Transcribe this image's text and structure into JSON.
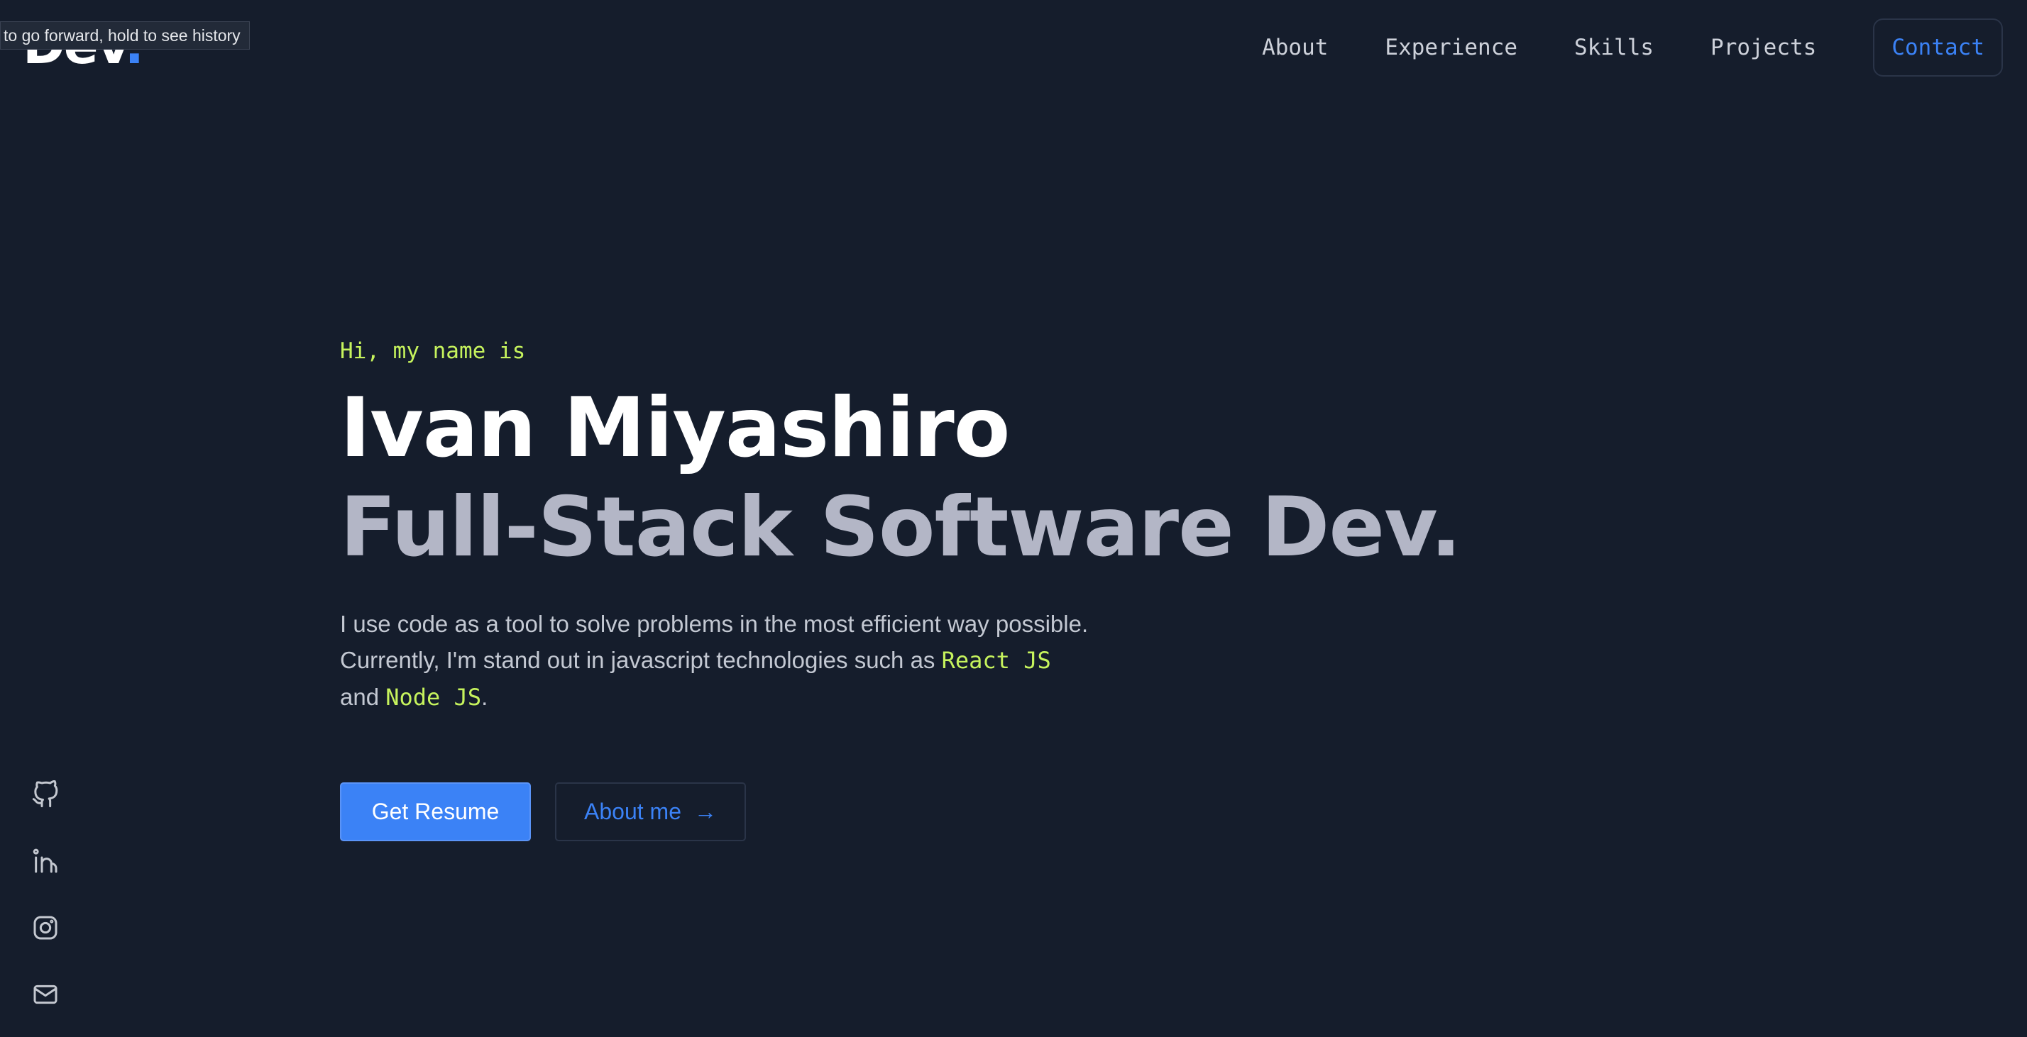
{
  "browser": {
    "tooltip": "to go forward, hold to see history"
  },
  "header": {
    "logo_text": "Dev",
    "logo_dot": ".",
    "nav": [
      {
        "label": "About"
      },
      {
        "label": "Experience"
      },
      {
        "label": "Skills"
      },
      {
        "label": "Projects"
      }
    ],
    "contact_label": "Contact"
  },
  "hero": {
    "greeting": "Hi, my name is",
    "name": "Ivan Miyashiro",
    "role": "Full-Stack Software Dev.",
    "desc_line1": "I use code as a tool to solve problems in the most efficient way possible.",
    "desc_line2_prefix": "Currently, I'm stand out in javascript technologies such as ",
    "desc_highlight1": "React JS",
    "desc_line3_prefix": "and ",
    "desc_highlight2": "Node JS",
    "desc_line3_suffix": ".",
    "primary_button": "Get Resume",
    "secondary_button": "About me",
    "secondary_arrow": "→"
  },
  "social": {
    "icons": [
      "github-icon",
      "linkedin-icon",
      "instagram-icon",
      "mail-icon"
    ]
  },
  "colors": {
    "background": "#151d2c",
    "accent": "#3b82f6",
    "highlight": "#c6f35d",
    "muted_heading": "#b3b6c6"
  }
}
